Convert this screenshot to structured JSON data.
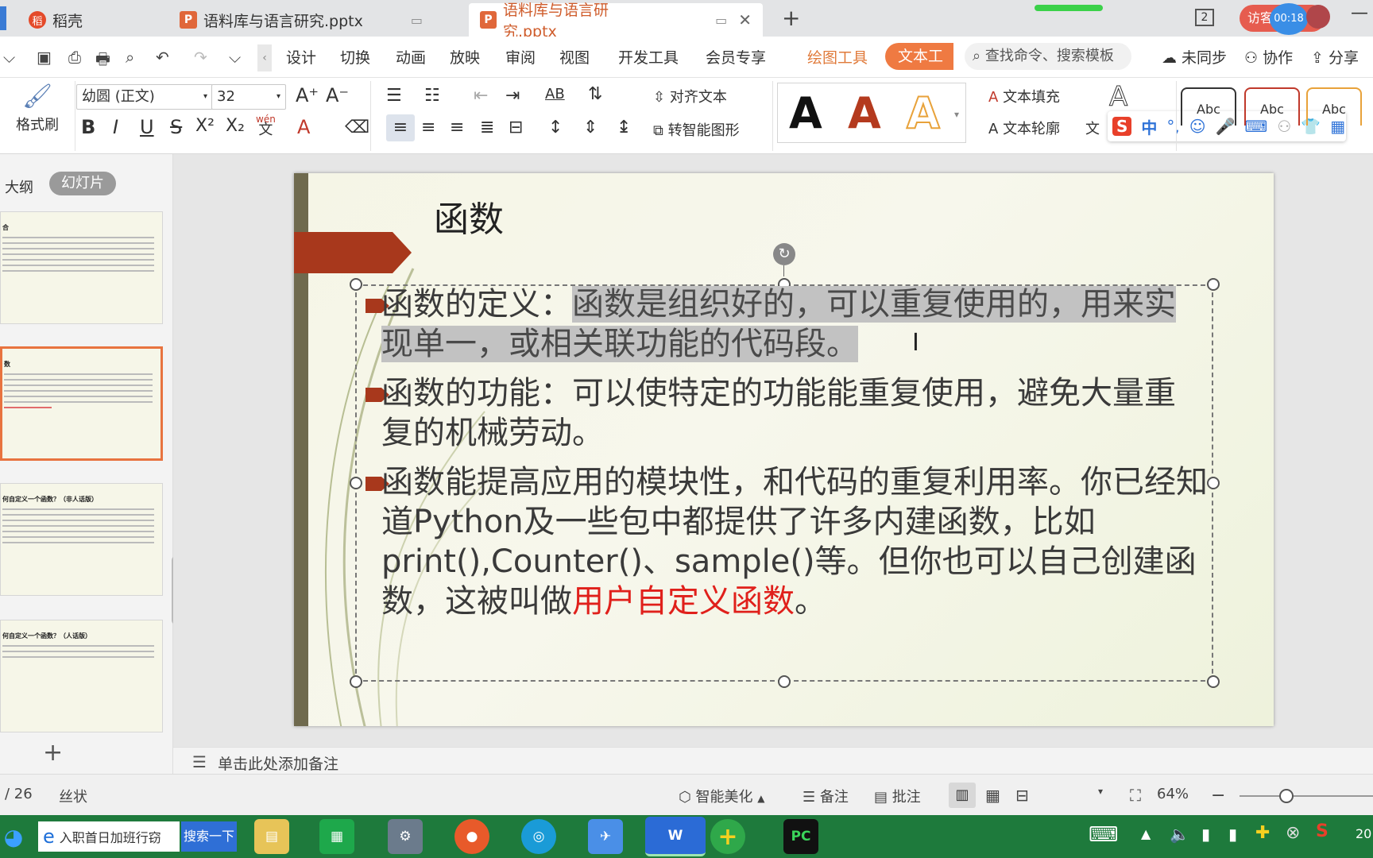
{
  "tabs": {
    "home": "稻壳",
    "doc1": "语料库与语言研究.pptx",
    "doc2": "语料库与语言研究.pptx",
    "new_tab": "+",
    "page_count": "2",
    "visitor": "访客",
    "timer": "00:18"
  },
  "menu": {
    "items": [
      "设计",
      "切换",
      "动画",
      "放映",
      "审阅",
      "视图",
      "开发工具",
      "会员专享"
    ],
    "drawing_tools": "绘图工具",
    "text_tools": "文本工具",
    "search_placeholder": "查找命令、搜索模板",
    "unsync": "未同步",
    "collab": "协作",
    "share": "分享"
  },
  "ribbon": {
    "format_painter": "格式刷",
    "font_name": "幼圆 (正文)",
    "font_size": "32",
    "align_text": "对齐文本",
    "smart_shape": "转智能图形",
    "text_fill": "文本填充",
    "text_outline": "文本轮廓",
    "text_effects": "文",
    "style_sample": "Abc",
    "wen_label": "wén",
    "ime_label": "中"
  },
  "leftpanel": {
    "outline_tab": "大纲",
    "slides_tab": "幻灯片",
    "add_slide": "+",
    "thumbs": [
      {
        "title": "合"
      },
      {
        "title": "数"
      },
      {
        "title": "何自定义一个函数？（非人话版）"
      },
      {
        "title": "何自定义一个函数？（人话版）"
      }
    ]
  },
  "slide": {
    "title": "函数",
    "b1_label": "函数的定义：",
    "b1_text": "函数是组织好的，可以重复使用的，用来实现单一，或相关联功能的代码段。",
    "b2_label": "函数的功能：",
    "b2_text": "可以使特定的功能能重复使用，避免大量重复的机械劳动。",
    "b3_text": "函数能提高应用的模块性，和代码的重复利用率。你已经知道Python及一些包中都提供了许多内建函数，比如print(),Counter()、sample()等。但你也可以自己创建函数，这被叫做",
    "b3_highlight": "用户自定义函数",
    "b3_end": "。"
  },
  "notes": {
    "placeholder": "单击此处添加备注"
  },
  "status": {
    "slide_num": "/ 26",
    "theme": "丝状",
    "beautify": "智能美化",
    "notes": "备注",
    "comments": "批注",
    "zoom": "64%"
  },
  "taskbar": {
    "search_input": "入职首日加班行窃",
    "search_button": "搜索一下",
    "clock": "20"
  },
  "colors": {
    "accent": "#cf5c2b",
    "slide_arrow": "#a8381c",
    "highlight_red": "#e0201b",
    "taskbar": "#1e7a3c"
  }
}
